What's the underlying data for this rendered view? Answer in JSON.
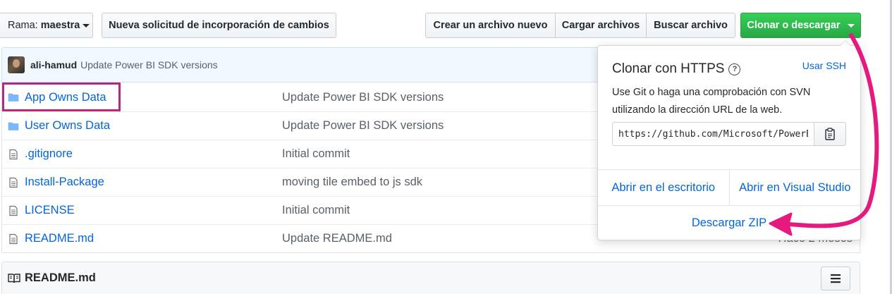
{
  "toolbar": {
    "branch_label": "Rama:",
    "branch_value": "maestra",
    "new_pr_label": "Nueva solicitud de incorporación de cambios",
    "create_file_label": "Crear un archivo nuevo",
    "upload_label": "Cargar archivos",
    "find_label": "Buscar archivo",
    "clone_label": "Clonar o descargar"
  },
  "commit": {
    "author": "ali-hamud",
    "message": "Update Power BI SDK versions"
  },
  "files": [
    {
      "name": "App Owns Data",
      "type": "folder",
      "message": "Update Power BI SDK versions",
      "age": ""
    },
    {
      "name": "User Owns Data",
      "type": "folder",
      "message": "Update Power BI SDK versions",
      "age": ""
    },
    {
      "name": ".gitignore",
      "type": "file",
      "message": "Initial commit",
      "age": ""
    },
    {
      "name": "Install-Package",
      "type": "file",
      "message": "moving tile embed to js sdk",
      "age": ""
    },
    {
      "name": "LICENSE",
      "type": "file",
      "message": "Initial commit",
      "age": ""
    },
    {
      "name": "README.md",
      "type": "file",
      "message": "Update README.md",
      "age": "Hace 2 meses"
    }
  ],
  "readme": {
    "title": "README.md"
  },
  "clone_popover": {
    "title": "Clonar con HTTPS",
    "help_glyph": "?",
    "ssh_link": "Usar SSH",
    "description": "Use Git o haga una comprobación con SVN utilizando la dirección URL de la web.",
    "url_value": "https://github.com/Microsoft/PowerBI-Developer-Samples.git",
    "open_desktop": "Abrir en el escritorio",
    "open_vs": "Abrir en Visual Studio",
    "download_zip": "Descargar ZIP"
  },
  "colors": {
    "accent_green": "#28a745",
    "link_blue": "#0366d6",
    "annotation_magenta": "#e6197f",
    "highlight_border": "#b4287f"
  }
}
